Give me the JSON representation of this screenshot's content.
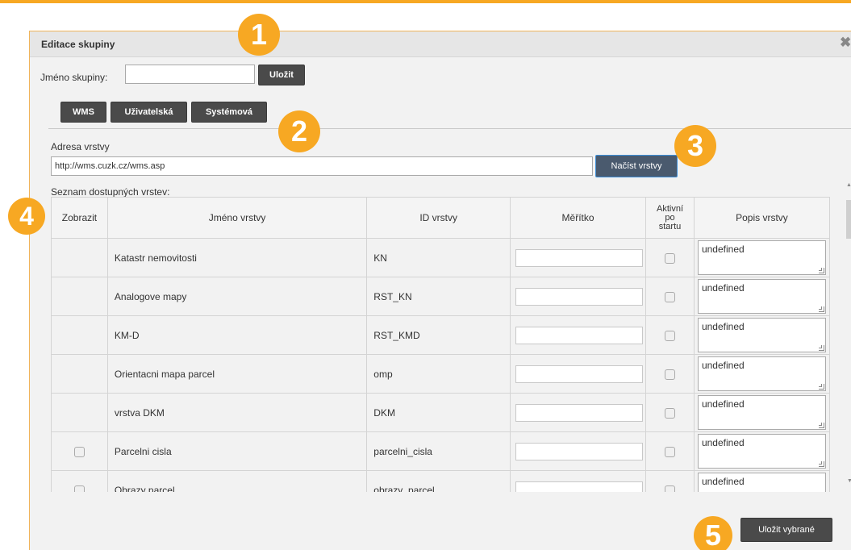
{
  "dialog": {
    "title": "Editace skupiny",
    "close_icon": "close-icon"
  },
  "group_name": {
    "label": "Jméno skupiny:",
    "value": "",
    "save_label": "Uložit"
  },
  "tabs": [
    {
      "label": "WMS"
    },
    {
      "label": "Uživatelská"
    },
    {
      "label": "Systémová"
    }
  ],
  "layer_address": {
    "label": "Adresa vrstvy",
    "value": "http://wms.cuzk.cz/wms.asp",
    "load_label": "Načíst vrstvy"
  },
  "layer_list": {
    "label": "Seznam dostupných vrstev:",
    "columns": [
      "Zobrazit",
      "Jméno vrstvy",
      "ID vrstvy",
      "Měřítko",
      "Aktivní po startu",
      "Popis vrstvy"
    ],
    "column_lines": {
      "active": [
        "Aktivní",
        "po",
        "startu"
      ]
    },
    "rows": [
      {
        "show_checkbox": false,
        "name": "Katastr nemovitosti",
        "id": "KN",
        "scale": "",
        "active": false,
        "description": "undefined"
      },
      {
        "show_checkbox": false,
        "name": "Analogove mapy",
        "id": "RST_KN",
        "scale": "",
        "active": false,
        "description": "undefined"
      },
      {
        "show_checkbox": false,
        "name": "KM-D",
        "id": "RST_KMD",
        "scale": "",
        "active": false,
        "description": "undefined"
      },
      {
        "show_checkbox": false,
        "name": "Orientacni mapa parcel",
        "id": "omp",
        "scale": "",
        "active": false,
        "description": "undefined"
      },
      {
        "show_checkbox": false,
        "name": "vrstva DKM",
        "id": "DKM",
        "scale": "",
        "active": false,
        "description": "undefined"
      },
      {
        "show_checkbox": true,
        "name": "Parcelni cisla",
        "id": "parcelni_cisla",
        "scale": "",
        "active": false,
        "description": "undefined"
      },
      {
        "show_checkbox": true,
        "name": "Obrazy parcel",
        "id": "obrazy_parcel",
        "scale": "",
        "active": false,
        "description": "undefined"
      }
    ]
  },
  "footer": {
    "save_selected_label": "Uložit vybrané"
  },
  "markers": [
    "1",
    "2",
    "3",
    "4",
    "5"
  ],
  "colors": {
    "accent": "#f7a823",
    "button": "#4a4a4a",
    "background": "#f2f2f2"
  }
}
